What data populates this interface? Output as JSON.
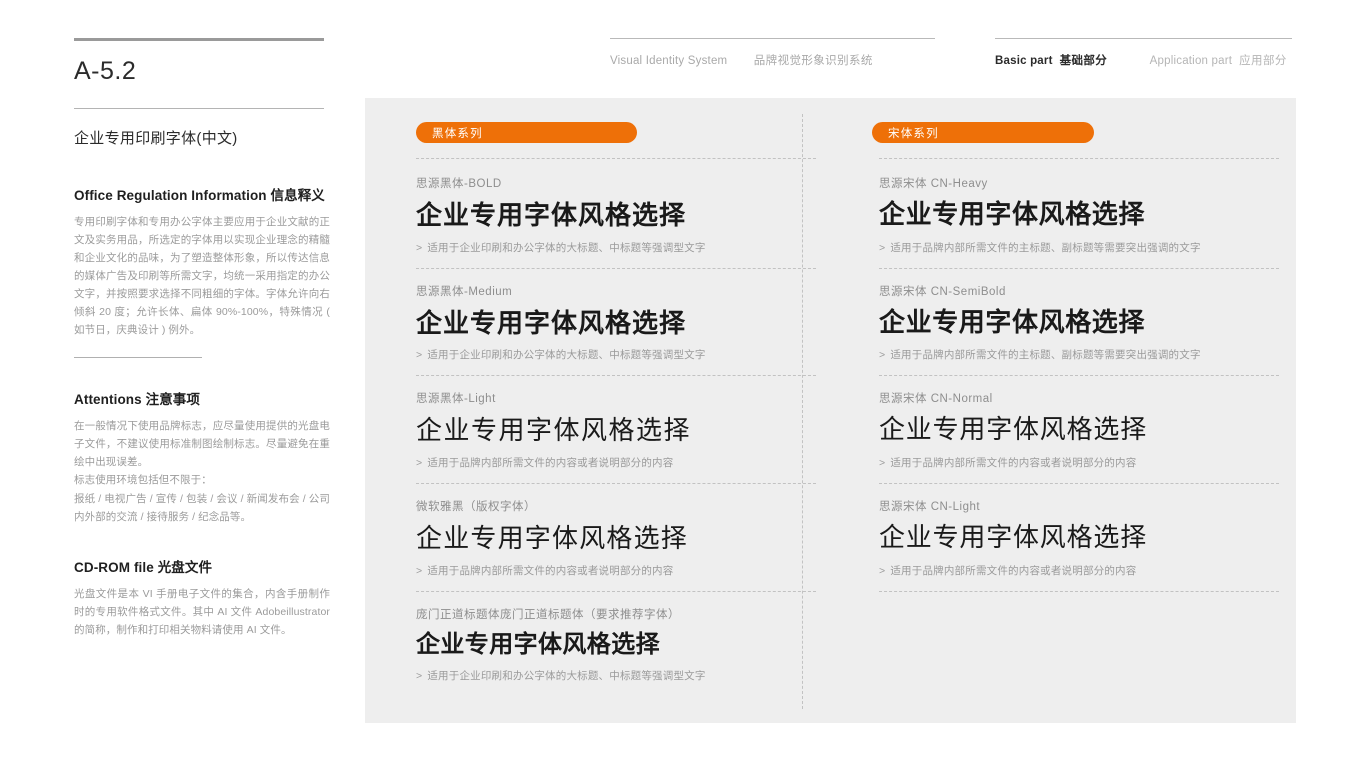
{
  "sidebar": {
    "doc_code": "A-5.2",
    "doc_subtitle": "企业专用印刷字体(中文)",
    "sections": [
      {
        "heading": "Office Regulation Information 信息释义",
        "body": "专用印刷字体和专用办公字体主要应用于企业文献的正文及实务用品，所选定的字体用以实现企业理念的精髓和企业文化的品味，为了塑造整体形象，所以传达信息的媒体广告及印刷等所需文字，均统一采用指定的办公文字，并按照要求选择不同粗细的字体。字体允许向右倾斜 20 度；允许长体、扁体 90%-100%，特殊情况 ( 如节日，庆典设计 ) 例外。"
      },
      {
        "heading": "Attentions 注意事项",
        "body": "在一般情况下使用品牌标志，应尽量使用提供的光盘电子文件，不建议使用标准制图绘制标志。尽量避免在重绘中出现误差。",
        "body2": "标志使用环境包括但不限于：",
        "body3": "报纸 / 电视广告 / 宣传 / 包装 / 会议 / 新闻发布会 / 公司内外部的交流 / 接待服务 / 纪念品等。"
      },
      {
        "heading": "CD-ROM file 光盘文件",
        "body": "光盘文件是本 VI 手册电子文件的集合，内含手册制作时的专用软件格式文件。其中 AI 文件 Adobeillustrator 的简称，制作和打印相关物料请使用 AI 文件。"
      }
    ]
  },
  "header": {
    "visual_identity_en": "Visual Identity System",
    "visual_identity_cn": "品牌视觉形象识别系统",
    "basic_part_en": "Basic part",
    "basic_part_cn": "基础部分",
    "application_part_en": "Application part",
    "application_part_cn": "应用部分"
  },
  "panel": {
    "accent_color": "#ee7008",
    "background_color": "#eeeeee",
    "pill_left_label": "黑体系列",
    "pill_right_label": "宋体系列",
    "left_column": [
      {
        "name": "思源黑体-BOLD",
        "sample": "企业专用字体风格选择",
        "note": "适用于企业印刷和办公字体的大标题、中标题等强调型文字"
      },
      {
        "name": "思源黑体-Medium",
        "sample": "企业专用字体风格选择",
        "note": "适用于企业印刷和办公字体的大标题、中标题等强调型文字"
      },
      {
        "name": "思源黑体-Light",
        "sample": "企业专用字体风格选择",
        "note": "适用于品牌内部所需文件的内容或者说明部分的内容"
      },
      {
        "name": "微软雅黑（版权字体）",
        "sample": "企业专用字体风格选择",
        "note": "适用于品牌内部所需文件的内容或者说明部分的内容"
      },
      {
        "name": "庞门正道标题体庞门正道标题体（要求推荐字体）",
        "sample": "企业专用字体风格选择",
        "note": "适用于企业印刷和办公字体的大标题、中标题等强调型文字"
      }
    ],
    "right_column": [
      {
        "name": "思源宋体 CN-Heavy",
        "sample": "企业专用字体风格选择",
        "note": "适用于品牌内部所需文件的主标题、副标题等需要突出强调的文字"
      },
      {
        "name": "思源宋体 CN-SemiBold",
        "sample": "企业专用字体风格选择",
        "note": "适用于品牌内部所需文件的主标题、副标题等需要突出强调的文字"
      },
      {
        "name": "思源宋体 CN-Normal",
        "sample": "企业专用字体风格选择",
        "note": "适用于品牌内部所需文件的内容或者说明部分的内容"
      },
      {
        "name": "思源宋体 CN-Light",
        "sample": "企业专用字体风格选择",
        "note": "适用于品牌内部所需文件的内容或者说明部分的内容"
      }
    ],
    "note_marker": ">"
  }
}
